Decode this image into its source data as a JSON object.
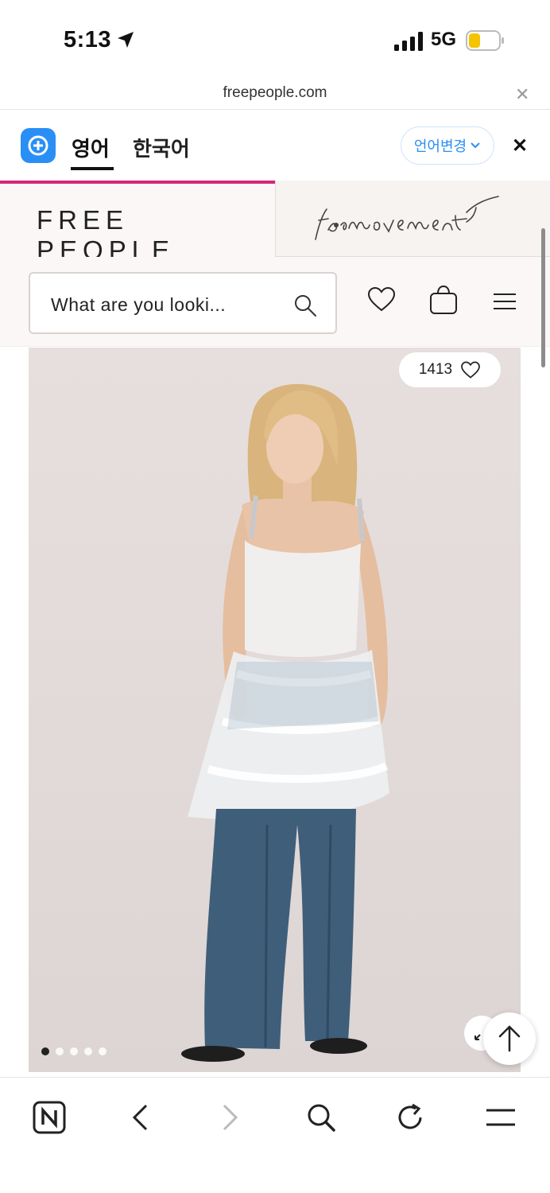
{
  "status_bar": {
    "time": "5:13",
    "network": "5G",
    "battery_color": "#f5c400"
  },
  "browser": {
    "url": "freepeople.com"
  },
  "translate_bar": {
    "tab_english": "영어",
    "tab_korean": "한국어",
    "change_language": "언어변경"
  },
  "site": {
    "brand_left": "FREE PEOPLE",
    "brand_right": "fp movement",
    "search_placeholder": "What are you looki...",
    "accent_color": "#d4267c"
  },
  "product": {
    "favorites_count": "1413",
    "image_count": 5,
    "active_image": 1
  },
  "toolbar": {
    "icons": [
      "home-n-icon",
      "back-icon",
      "forward-icon",
      "search-icon",
      "refresh-icon",
      "menu-icon"
    ]
  }
}
